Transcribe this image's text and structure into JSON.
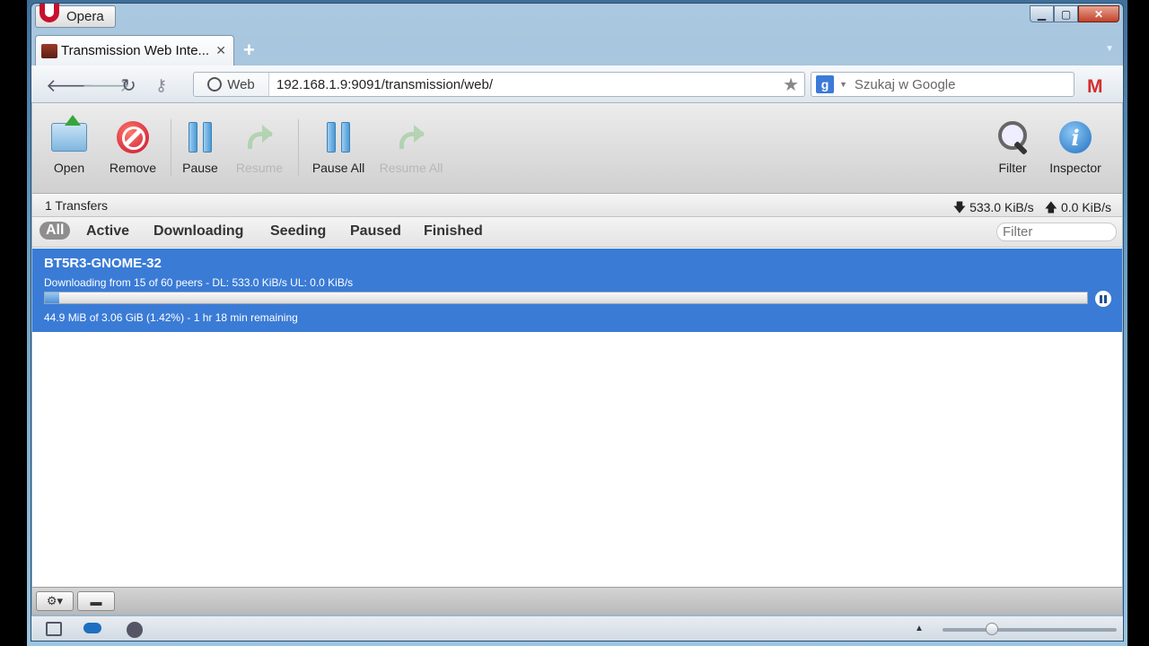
{
  "browser": {
    "app_name": "Opera",
    "tab_title": "Transmission Web Inte...",
    "address_mode": "Web",
    "url": "192.168.1.9:9091/transmission/web/",
    "search_placeholder": "Szukaj w Google",
    "search_engine_letter": "g",
    "gmail_letter": "M"
  },
  "toolbar": {
    "open": "Open",
    "remove": "Remove",
    "pause": "Pause",
    "resume": "Resume",
    "pause_all": "Pause All",
    "resume_all": "Resume All",
    "filter": "Filter",
    "inspector": "Inspector"
  },
  "status": {
    "transfers": "1 Transfers",
    "download_speed": "533.0 KiB/s",
    "upload_speed": "0.0 KiB/s"
  },
  "filters": {
    "tabs": [
      "All",
      "Active",
      "Downloading",
      "Seeding",
      "Paused",
      "Finished"
    ],
    "selected": "All",
    "search_placeholder": "Filter"
  },
  "torrents": [
    {
      "name": "BT5R3-GNOME-32",
      "peers": "Downloading from 15 of 60 peers - DL: 533.0 KiB/s UL: 0.0 KiB/s",
      "progress_text": "44.9 MiB of 3.06 GiB (1.42%) - 1 hr 18 min remaining",
      "progress_fraction": 0.0142
    }
  ],
  "colors": {
    "selected_row": "#3a7bd6",
    "remove_red": "#c8102e",
    "opera_red": "#c8102e"
  }
}
